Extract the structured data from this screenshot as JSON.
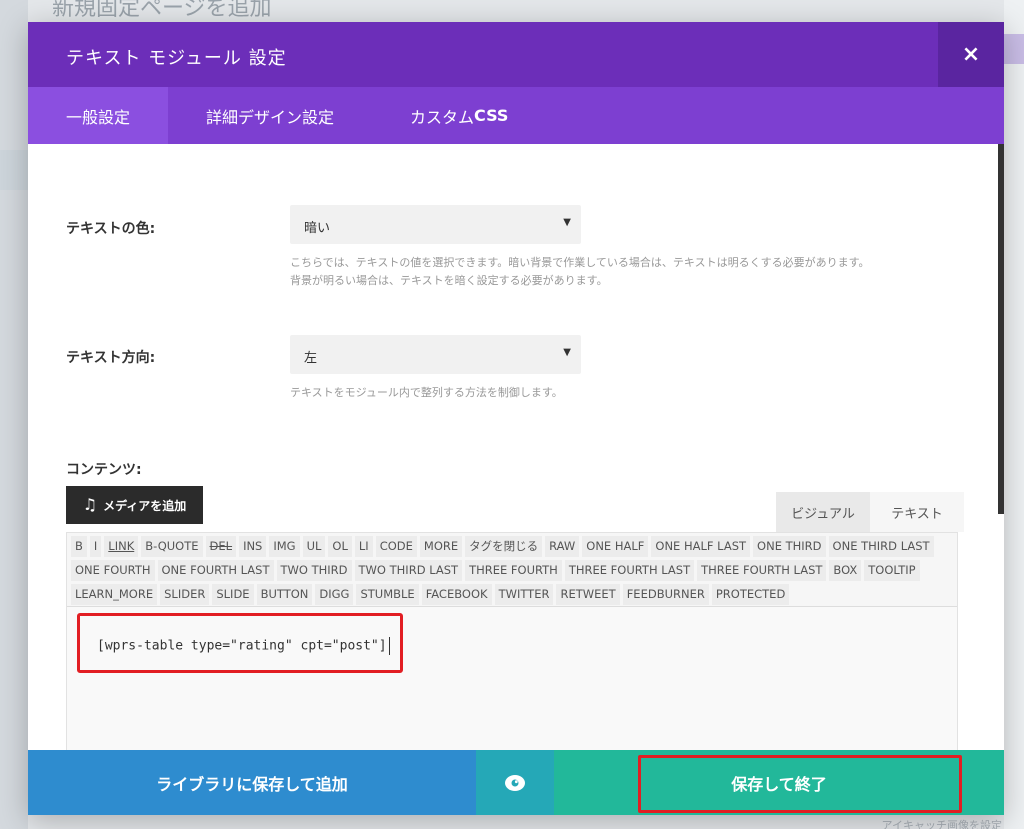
{
  "backdrop": {
    "page_title": "新規固定ページを追加",
    "footnote": "アイキャッチ画像を設定"
  },
  "modal": {
    "title": "テキスト モジュール 設定",
    "close_label": "×",
    "tabs": [
      {
        "label": "一般設定"
      },
      {
        "label_prefix": "カスタム ",
        "label": "詳細デザイン設定"
      },
      {
        "label_prefix": "カスタム ",
        "label_strong": "CSS"
      }
    ]
  },
  "fields": {
    "text_color": {
      "label": "テキストの色:",
      "value": "暗い",
      "help": "こちらでは、テキストの値を選択できます。暗い背景で作業している場合は、テキストは明るくする必要があります。背景が明るい場合は、テキストを暗く設定する必要があります。"
    },
    "text_direction": {
      "label": "テキスト方向:",
      "value": "左",
      "help": "テキストをモジュール内で整列する方法を制御します。"
    },
    "content": {
      "label": "コンテンツ:"
    }
  },
  "editor": {
    "media_button": "メディアを追加",
    "mode_visual": "ビジュアル",
    "mode_text": "テキスト",
    "quicktags": [
      "B",
      "I",
      "LINK",
      "B-QUOTE",
      "DEL",
      "INS",
      "IMG",
      "UL",
      "OL",
      "LI",
      "CODE",
      "MORE",
      "タグを閉じる",
      "RAW",
      "ONE HALF",
      "ONE HALF LAST",
      "ONE THIRD",
      "ONE THIRD LAST",
      "ONE FOURTH",
      "ONE FOURTH LAST",
      "TWO THIRD",
      "TWO THIRD LAST",
      "THREE FOURTH",
      "THREE FOURTH LAST",
      "THREE FOURTH LAST",
      "BOX",
      "TOOLTIP",
      "LEARN_MORE",
      "SLIDER",
      "SLIDE",
      "BUTTON",
      "DIGG",
      "STUMBLE",
      "FACEBOOK",
      "TWITTER",
      "RETWEET",
      "FEEDBURNER",
      "PROTECTED"
    ],
    "content": "[wprs-table type=\"rating\" cpt=\"post\"]"
  },
  "footer": {
    "save_library": "ライブラリに保存して追加",
    "save_exit": "保存して終了"
  },
  "colors": {
    "header": "#6c2eb9",
    "tabs": "#7d3fd1",
    "library_button": "#2e8ccf",
    "preview_button": "#25a8b7",
    "save_button": "#22b89a",
    "highlight": "#e21e23"
  }
}
